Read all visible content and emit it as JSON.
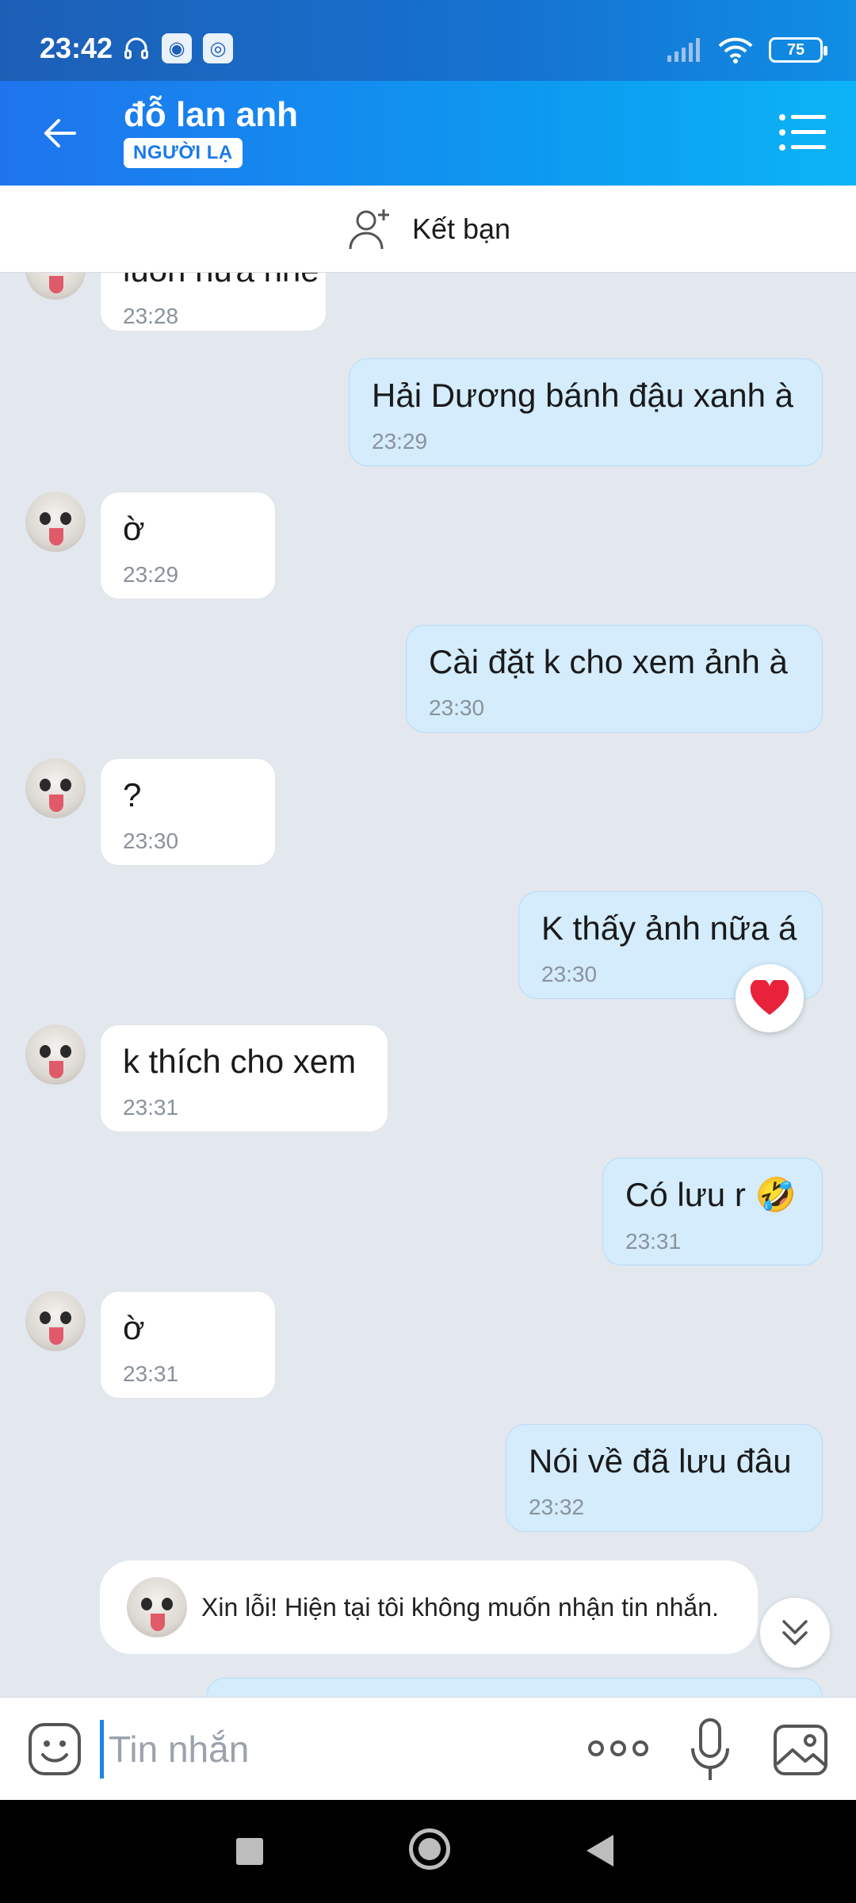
{
  "status_bar": {
    "time": "23:42",
    "battery": "75"
  },
  "header": {
    "contact_name": "đỗ lan anh",
    "badge": "NGƯỜI LẠ"
  },
  "add_friend": {
    "label": "Kết bạn"
  },
  "messages": [
    {
      "text": "luôn nữa nhé",
      "time": "23:28"
    },
    {
      "text": "Hải Dương bánh đậu xanh à",
      "time": "23:29"
    },
    {
      "text": "ờ",
      "time": "23:29"
    },
    {
      "text": "Cài đặt k cho xem ảnh à",
      "time": "23:30"
    },
    {
      "text": "?",
      "time": "23:30"
    },
    {
      "text": "K thấy ảnh nữa á",
      "time": "23:30"
    },
    {
      "text": "k thích cho xem",
      "time": "23:31"
    },
    {
      "text": "Có lưu r 🤣",
      "time": "23:31"
    },
    {
      "text": "ờ",
      "time": "23:31"
    },
    {
      "text": "Nói về đã lưu đâu",
      "time": "23:32"
    }
  ],
  "reaction": {
    "emoji": "❤️"
  },
  "notice": {
    "text": "Xin lỗi! Hiện tại tôi không muốn nhận tin nhắn."
  },
  "input": {
    "placeholder": "Tin nhắn"
  },
  "colors": {
    "header_start": "#1f74ee",
    "header_end": "#0cb4f6",
    "outgoing_bubble": "#d4ecfc",
    "incoming_bubble": "#ffffff",
    "chat_bg": "#e3e8ef"
  }
}
